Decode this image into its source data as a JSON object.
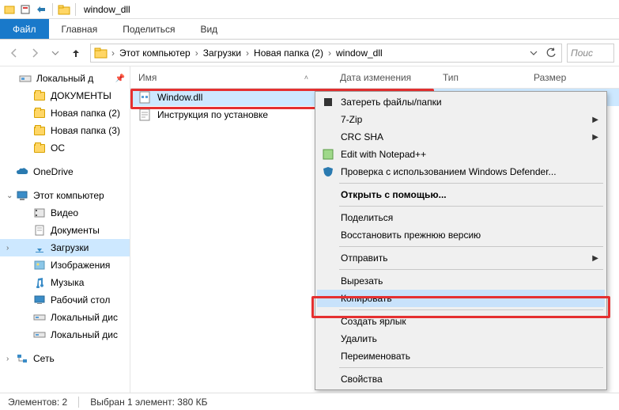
{
  "window": {
    "title": "window_dll"
  },
  "ribbon": {
    "file": "Файл",
    "home": "Главная",
    "share": "Поделиться",
    "view": "Вид"
  },
  "breadcrumbs": [
    "Этот компьютер",
    "Загрузки",
    "Новая папка (2)",
    "window_dll"
  ],
  "search": {
    "placeholder": "Поис"
  },
  "tree": {
    "quick": {
      "label": "Локальный д",
      "items": [
        "ДОКУМЕНТЫ",
        "Новая папка (2)",
        "Новая папка (3)",
        "ОС"
      ]
    },
    "onedrive": "OneDrive",
    "thispc": {
      "label": "Этот компьютер",
      "items": [
        "Видео",
        "Документы",
        "Загрузки",
        "Изображения",
        "Музыка",
        "Рабочий стол",
        "Локальный дис",
        "Локальный дис"
      ]
    },
    "network": "Сеть"
  },
  "columns": {
    "name": "Имя",
    "date": "Дата изменения",
    "type": "Тип",
    "size": "Размер"
  },
  "files": [
    {
      "name": "Window.dll"
    },
    {
      "name": "Инструкция по установке"
    }
  ],
  "context_menu": {
    "shred": "Затереть файлы/папки",
    "sevenzip": "7-Zip",
    "crcsha": "CRC SHA",
    "notepadpp": "Edit with Notepad++",
    "defender": "Проверка с использованием Windows Defender...",
    "openwith": "Открыть с помощью...",
    "share": "Поделиться",
    "restore": "Восстановить прежнюю версию",
    "sendto": "Отправить",
    "cut": "Вырезать",
    "copy": "Копировать",
    "shortcut": "Создать ярлык",
    "delete": "Удалить",
    "rename": "Переименовать",
    "properties": "Свойства"
  },
  "status": {
    "count": "Элементов: 2",
    "selection": "Выбран 1 элемент: 380 КБ"
  }
}
